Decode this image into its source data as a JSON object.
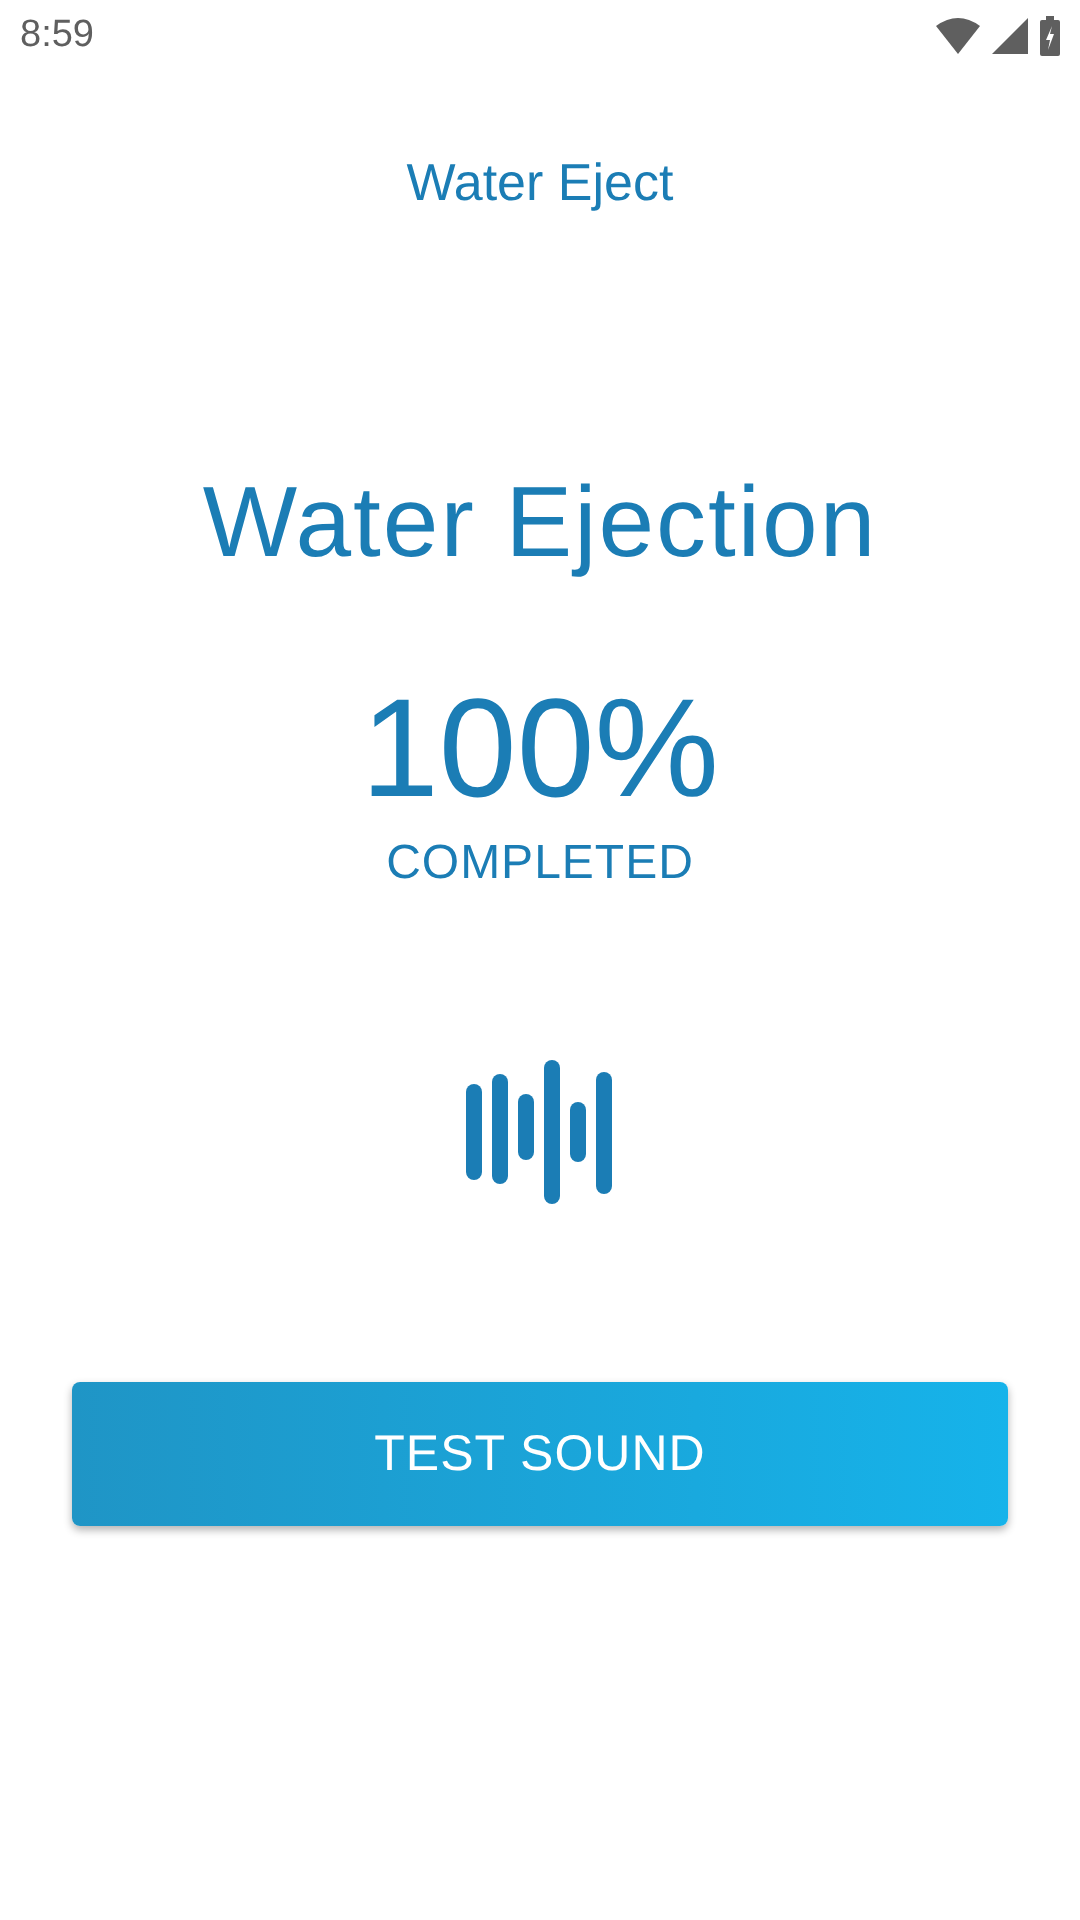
{
  "status_bar": {
    "time": "8:59"
  },
  "app_bar": {
    "title": "Water Eject"
  },
  "heading": "Water Ejection",
  "progress": {
    "percent": "100%",
    "label": "COMPLETED"
  },
  "button": {
    "label": "TEST SOUND"
  }
}
